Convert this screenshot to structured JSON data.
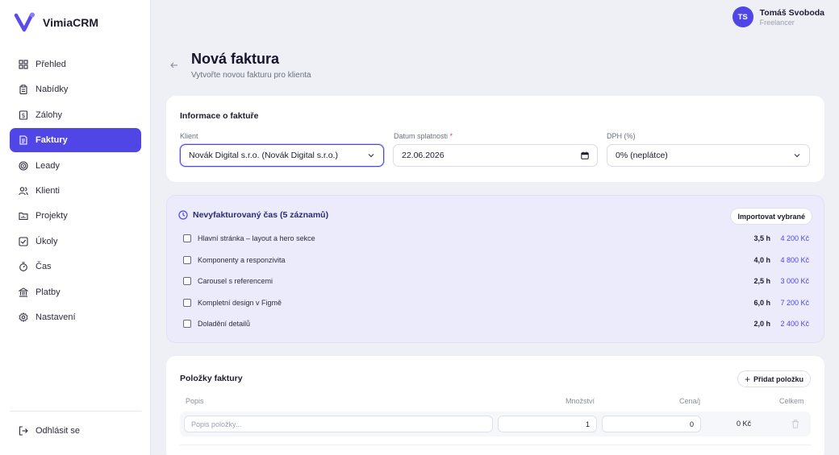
{
  "app": {
    "name": "VimiaCRM"
  },
  "sidebar": {
    "items": [
      {
        "label": "Přehled",
        "icon": "dashboard-icon",
        "active": false
      },
      {
        "label": "Nabídky",
        "icon": "clipboard-icon",
        "active": false
      },
      {
        "label": "Zálohy",
        "icon": "dollar-document-icon",
        "active": false
      },
      {
        "label": "Faktury",
        "icon": "invoice-icon",
        "active": true
      },
      {
        "label": "Leady",
        "icon": "target-icon",
        "active": false
      },
      {
        "label": "Klienti",
        "icon": "users-icon",
        "active": false
      },
      {
        "label": "Projekty",
        "icon": "folder-icon",
        "active": false
      },
      {
        "label": "Úkoly",
        "icon": "checkbox-icon",
        "active": false
      },
      {
        "label": "Čas",
        "icon": "stopwatch-icon",
        "active": false
      },
      {
        "label": "Platby",
        "icon": "bank-icon",
        "active": false
      },
      {
        "label": "Nastavení",
        "icon": "gear-icon",
        "active": false
      }
    ],
    "logout_label": "Odhlásit se"
  },
  "user": {
    "initials": "TS",
    "name": "Tomáš Svoboda",
    "role": "Freelancer"
  },
  "header": {
    "title": "Nová faktura",
    "subtitle": "Vytvořte novou fakturu pro klienta"
  },
  "invoice_info": {
    "title": "Informace o faktuře",
    "client_label": "Klient",
    "client_value": "Novák Digital s.r.o. (Novák Digital s.r.o.)",
    "due_label": "Datum splatnosti",
    "due_required": "*",
    "due_value": "22.06.2026",
    "vat_label": "DPH (%)",
    "vat_value": "0% (neplátce)"
  },
  "unbilled": {
    "title": "Nevyfakturovaný čas (5 záznamů)",
    "import_label": "Importovat vybrané",
    "entries": [
      {
        "desc": "Hlavní stránka – layout a hero sekce",
        "hours": "3,5 h",
        "amount": "4 200 Kč"
      },
      {
        "desc": "Komponenty a responzivita",
        "hours": "4,0 h",
        "amount": "4 800 Kč"
      },
      {
        "desc": "Carousel s referencemi",
        "hours": "2,5 h",
        "amount": "3 000 Kč"
      },
      {
        "desc": "Kompletní design v Figmě",
        "hours": "6,0 h",
        "amount": "7 200 Kč"
      },
      {
        "desc": "Doladění detailů",
        "hours": "2,0 h",
        "amount": "2 400 Kč"
      }
    ]
  },
  "items": {
    "title": "Položky faktury",
    "add_label": "Přidat položku",
    "columns": {
      "desc": "Popis",
      "qty": "Množství",
      "price": "Cena/j",
      "total": "Celkem"
    },
    "row": {
      "desc_placeholder": "Popis položky...",
      "qty": "1",
      "price": "0",
      "total": "0 Kč"
    }
  },
  "colors": {
    "accent": "#4f46e5",
    "background": "#eef0f6",
    "time_card": "#ebebfb"
  }
}
